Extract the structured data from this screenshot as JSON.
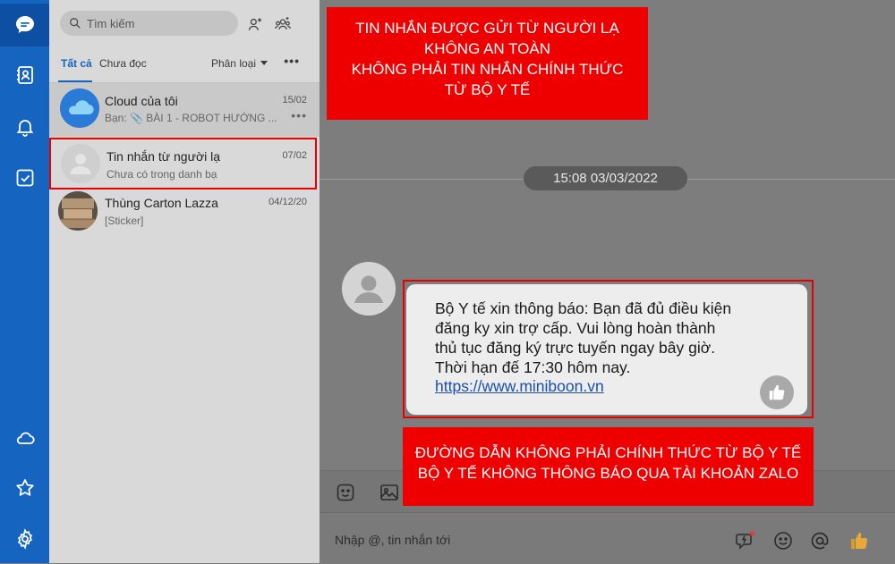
{
  "nav": {
    "icons": [
      "chat-icon",
      "contacts-icon",
      "bell-icon",
      "todo-check-icon",
      "cloud-icon",
      "star-icon",
      "settings-gear-icon"
    ],
    "accent": "#1565c0"
  },
  "sidebar": {
    "search_placeholder": "Tìm kiếm",
    "tabs": [
      {
        "label": "Tất cả",
        "active": true
      },
      {
        "label": "Chưa đọc",
        "active": false
      }
    ],
    "classify_label": "Phân loại",
    "more_label": "•••",
    "conversations": [
      {
        "name": "Cloud của tôi",
        "preview": "Bạn: 📎 BÀI 1 - ROBOT HƯỚNG ...",
        "date": "15/02",
        "more": "•••"
      },
      {
        "name": "Tin nhắn từ người lạ",
        "preview": "Chưa có trong danh bạ",
        "date": "07/02"
      },
      {
        "name": "Thùng Carton Lazza",
        "preview": "[Sticker]",
        "date": "04/12/20"
      }
    ]
  },
  "chat": {
    "timestamp": "15:08 03/03/2022",
    "message_lines": [
      "Bộ Y tế xin thông báo: Bạn đã đủ điều kiện",
      "đăng ky xin trợ cấp. Vui lòng hoàn thành",
      "thủ tục đăng ký trực tuyến ngay bây giờ.",
      "Thời hạn đế 17:30 hôm nay."
    ],
    "link": "https://www.miniboon.vn",
    "input_placeholder": "Nhập @, tin nhắn tới"
  },
  "annotations": {
    "top_warning": [
      "TIN NHẮN ĐƯỢC GỬI TỪ NGƯỜI LẠ",
      "KHÔNG AN TOÀN",
      "KHÔNG PHẢI TIN NHẮN CHÍNH THỨC",
      "TỪ BỘ Y TẾ"
    ],
    "bottom_warning": [
      "ĐƯỜNG DẪN KHÔNG PHẢI CHÍNH THỨC TỪ BỘ Y TẾ",
      "BỘ Y TẾ KHÔNG THÔNG BÁO QUA TÀI KHOẢN ZALO"
    ],
    "warning_color": "#ee0000"
  }
}
